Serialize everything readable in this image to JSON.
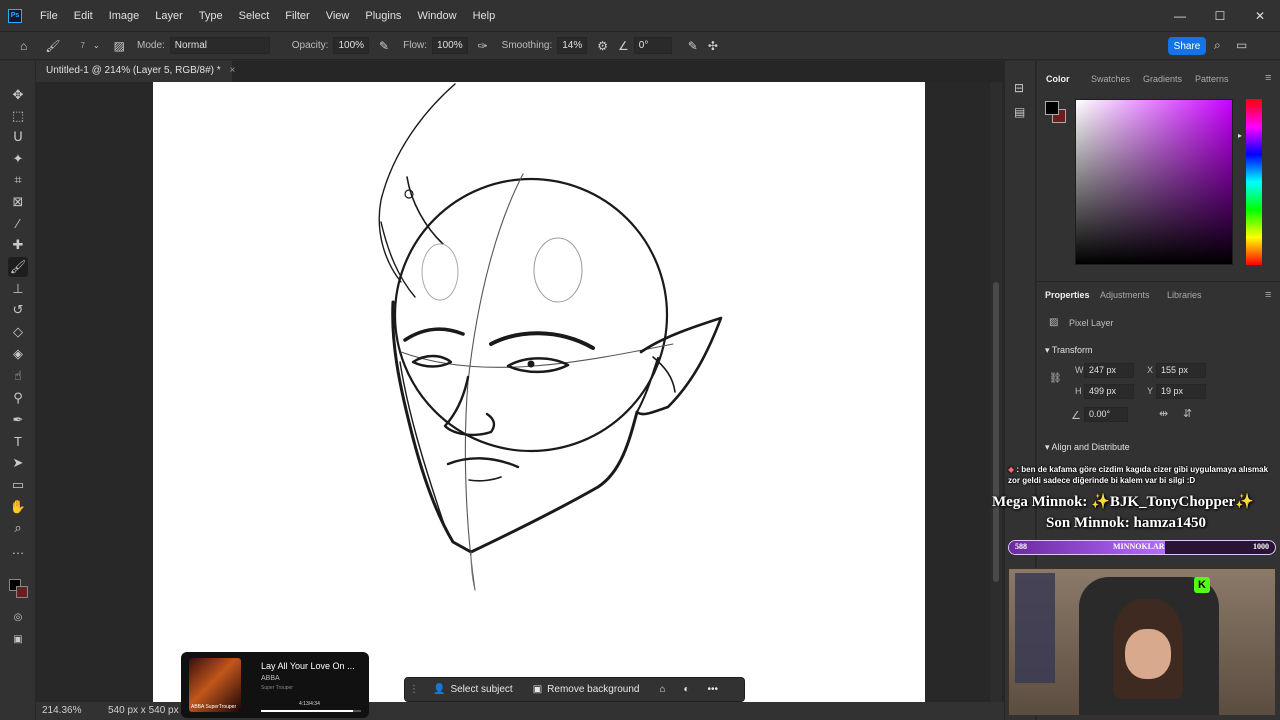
{
  "app": {
    "logo_text": "Ps",
    "menu": [
      "File",
      "Edit",
      "Image",
      "Layer",
      "Type",
      "Select",
      "Filter",
      "View",
      "Plugins",
      "Window",
      "Help"
    ],
    "window_controls": {
      "minimize": "—",
      "maximize": "☐",
      "close": "✕"
    }
  },
  "options_bar": {
    "brush_size": "7",
    "mode_label": "Mode:",
    "mode_value": "Normal",
    "opacity_label": "Opacity:",
    "opacity_value": "100%",
    "flow_label": "Flow:",
    "flow_value": "100%",
    "smoothing_label": "Smoothing:",
    "smoothing_value": "14%",
    "angle_value": "0°",
    "share_label": "Share"
  },
  "document": {
    "tab_title": "Untitled-1 @ 214% (Layer 5, RGB/8#) *",
    "tab_close": "×"
  },
  "status": {
    "zoom": "214.36%",
    "doc_size": "540 px x 540 px (72 ppi)"
  },
  "panels": {
    "color_tabs": [
      "Color",
      "Swatches",
      "Gradients",
      "Patterns"
    ],
    "props_tabs": [
      "Properties",
      "Adjustments",
      "Libraries"
    ],
    "layer_kind": "Pixel Layer",
    "transform_title": "Transform",
    "w_label": "W",
    "w_value": "247 px",
    "h_label": "H",
    "h_value": "499 px",
    "x_label": "X",
    "x_value": "155 px",
    "y_label": "Y",
    "y_value": "19 px",
    "angle_value": "0.00°",
    "align_title": "Align and Distribute",
    "colors": {
      "foreground": "#000000",
      "background": "#6b1e1e",
      "accent": "#1473e6"
    }
  },
  "stream": {
    "chat_message": ": ben de kafama göre cizdim kagıda cizer gibi uygulamaya alısmak zor geldi sadece diğerinde bi kalem var bi silgi :D",
    "mega_minnok": "Mega Minnok: ✨BJK_TonyChopper✨",
    "son_minnok": "Son Minnok: hamza1450",
    "goal_current": "588",
    "goal_title": "MINNOKLAR",
    "goal_target": "1000",
    "goal_progress": 0.588
  },
  "music": {
    "title": "Lay All Your Love On ...",
    "artist": "ABBA",
    "album": "Super Trouper",
    "time": "4:13/4:34",
    "album_caption": "ABBA SuperTrouper",
    "progress": 0.92
  },
  "task_bar": {
    "select_subject": "Select subject",
    "remove_background": "Remove background",
    "more": "•••"
  }
}
